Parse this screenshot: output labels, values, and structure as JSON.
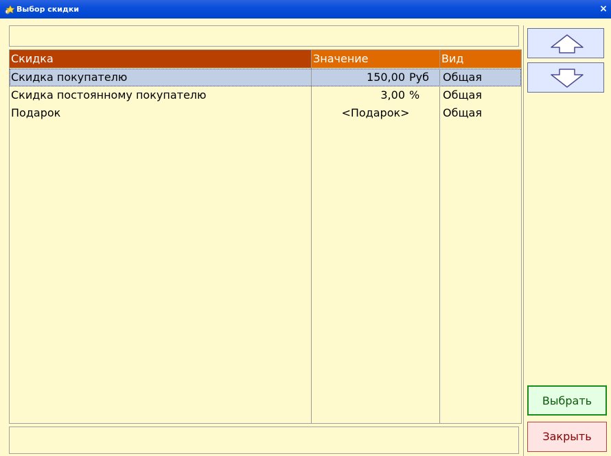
{
  "window": {
    "title": "Выбор скидки",
    "close_glyph": "×"
  },
  "table": {
    "columns": [
      "Скидка",
      "Значение",
      "",
      "Вид"
    ],
    "header_colors": {
      "col1": "#b84000",
      "col2": "#e06a00",
      "col4": "#e06a00"
    },
    "rows": [
      {
        "name": "Скидка покупателю",
        "value": "150,00",
        "unit": "Руб",
        "kind": "Общая",
        "selected": true
      },
      {
        "name": "Скидка постоянному покупателю",
        "value": "3,00",
        "unit": "%",
        "kind": "Общая",
        "selected": false
      },
      {
        "name": "Подарок",
        "value": "<Подарок>",
        "unit": "",
        "kind": "Общая",
        "selected": false
      }
    ]
  },
  "buttons": {
    "up_icon": "arrow-up-icon",
    "down_icon": "arrow-down-icon",
    "select_label": "Выбрать",
    "close_label": "Закрыть"
  },
  "colors": {
    "background": "#fffacd",
    "selection": "#c0cfe4",
    "titlebar": "#0a4fdb"
  }
}
